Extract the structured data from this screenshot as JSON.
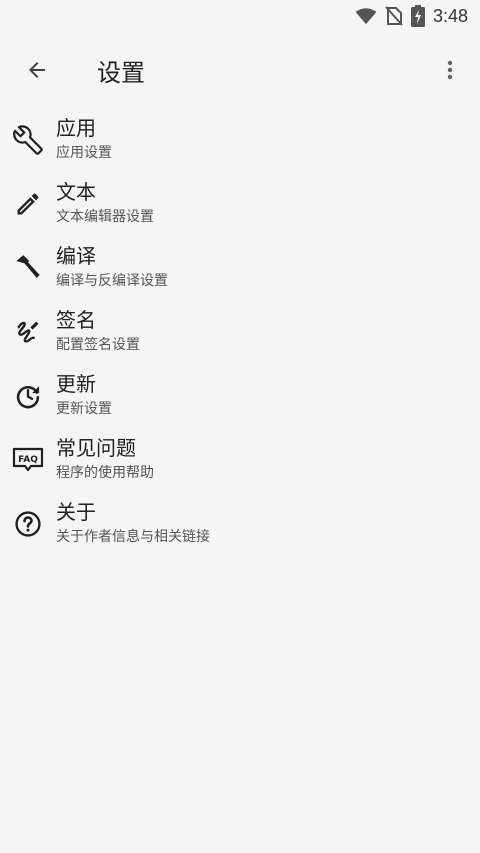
{
  "status_bar": {
    "time": "3:48",
    "icons": [
      "wifi-icon",
      "no-sim-icon",
      "battery-charging-icon"
    ]
  },
  "app_bar": {
    "title": "设置",
    "back_icon": "arrow-back-icon",
    "more_icon": "more-vert-icon"
  },
  "menu": {
    "items": [
      {
        "title": "应用",
        "subtitle": "应用设置",
        "icon": "wrench-icon"
      },
      {
        "title": "文本",
        "subtitle": "文本编辑器设置",
        "icon": "pencil-icon"
      },
      {
        "title": "编译",
        "subtitle": "编译与反编译设置",
        "icon": "hammer-icon"
      },
      {
        "title": "签名",
        "subtitle": "配置签名设置",
        "icon": "signature-icon"
      },
      {
        "title": "更新",
        "subtitle": "更新设置",
        "icon": "update-clock-icon"
      },
      {
        "title": "常见问题",
        "subtitle": "程序的使用帮助",
        "icon": "faq-icon"
      },
      {
        "title": "关于",
        "subtitle": "关于作者信息与相关链接",
        "icon": "help-circle-icon"
      }
    ]
  }
}
